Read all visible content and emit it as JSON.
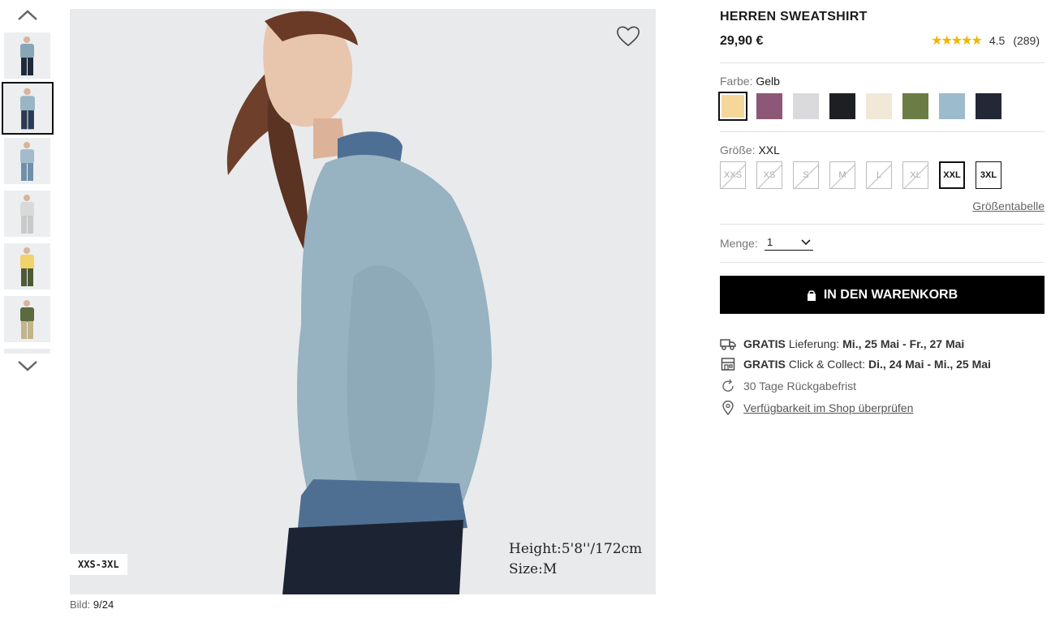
{
  "gallery": {
    "thumbnails": [
      {
        "shirt": "#8aa6b6",
        "pants": "#1e2a3a"
      },
      {
        "shirt": "#9ab5c3",
        "pants": "#2a3a55",
        "active": true
      },
      {
        "shirt": "#a3bccb",
        "pants": "#6f8faa"
      },
      {
        "shirt": "#d9d9d9",
        "pants": "#c9c9c9"
      },
      {
        "shirt": "#f0d36a",
        "pants": "#4c5a36"
      },
      {
        "shirt": "#5c6b3f",
        "pants": "#c2b48e"
      }
    ],
    "size_tag": "XXS-3XL",
    "model_height": "Height:5'8''/172cm",
    "model_size": "Size:M",
    "counter_label": "Bild:",
    "counter_value": "9/24"
  },
  "product": {
    "title": "HERREN SWEATSHIRT",
    "price": "29,90 €",
    "rating_stars": "★★★★★",
    "rating_value": "4.5",
    "rating_count": "(289)"
  },
  "color": {
    "label": "Farbe:",
    "selected": "Gelb",
    "swatches": [
      "#f5d79a",
      "#8d5878",
      "#dadadc",
      "#1d1f22",
      "#f2e8d8",
      "#6b7c45",
      "#9cbbcc",
      "#232736"
    ]
  },
  "size": {
    "label": "Größe:",
    "selected": "XXL",
    "options": [
      "XXS",
      "XS",
      "S",
      "M",
      "L",
      "XL",
      "XXL",
      "3XL"
    ],
    "chart_link": "Größentabelle"
  },
  "quantity": {
    "label": "Menge:",
    "value": "1"
  },
  "cart": {
    "button_label": "IN DEN WARENKORB"
  },
  "services": {
    "delivery": {
      "bold": "GRATIS",
      "text": "Lieferung:",
      "dates": "Mi., 25 Mai - Fr., 27 Mai"
    },
    "collect": {
      "bold": "GRATIS",
      "text": "Click & Collect:",
      "dates": "Di., 24 Mai - Mi., 25 Mai"
    },
    "returns": "30 Tage Rückgabefrist",
    "store_check": "Verfügbarkeit im Shop überprüfen"
  }
}
